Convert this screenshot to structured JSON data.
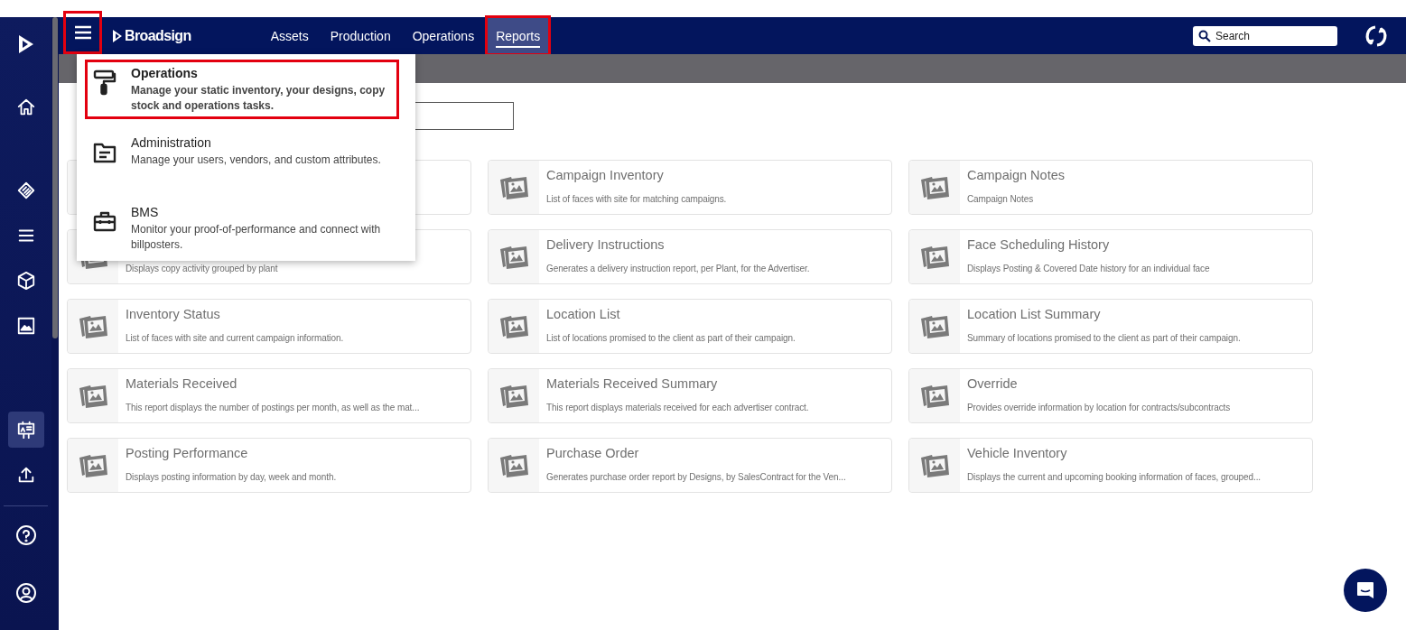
{
  "sidebar": {
    "items": [
      {
        "selected": false
      },
      {
        "selected": false
      },
      {
        "selected": false
      },
      {
        "selected": false
      },
      {
        "selected": false
      },
      {
        "selected": true
      },
      {
        "selected": false
      }
    ],
    "bottom_items": [
      {
        "selected": false
      },
      {
        "selected": false
      }
    ]
  },
  "header": {
    "menu_button": {
      "highlighted": true
    },
    "brand": "Broadsign",
    "tabs": [
      {
        "label": "Assets",
        "selected": false,
        "highlighted": false
      },
      {
        "label": "Production",
        "selected": false,
        "highlighted": false
      },
      {
        "label": "Operations",
        "selected": false,
        "highlighted": false
      },
      {
        "label": "Reports",
        "selected": true,
        "highlighted": true
      }
    ],
    "search": {
      "placeholder": "Search"
    }
  },
  "app_menu": {
    "items": [
      {
        "title": "Operations",
        "description": "Manage your static inventory, your designs, copy stock and operations tasks.",
        "highlighted": true
      },
      {
        "title": "Administration",
        "description": "Manage your users, vendors, and custom attributes.",
        "highlighted": false
      },
      {
        "title": "BMS",
        "description": "Monitor your proof-of-performance and connect with billposters.",
        "highlighted": false
      }
    ]
  },
  "report_rows": [
    {
      "cards": [
        {
          "kind": "covered"
        },
        {
          "kind": "report",
          "title": "Campaign Inventory",
          "description": "List of faces with site for matching campaigns."
        },
        {
          "kind": "report",
          "title": "Campaign Notes",
          "description": "Campaign Notes"
        }
      ]
    },
    {
      "cards": [
        {
          "kind": "covered",
          "description": "Displays copy activity grouped by plant"
        },
        {
          "kind": "report",
          "title": "Delivery Instructions",
          "description": "Generates a delivery instruction report, per Plant, for the Advertiser."
        },
        {
          "kind": "report",
          "title": "Face Scheduling History",
          "description": "Displays Posting & Covered Date history for an individual face"
        }
      ]
    },
    {
      "cards": [
        {
          "kind": "report",
          "title": "Inventory Status",
          "description": "List of faces with site and current campaign information."
        },
        {
          "kind": "report",
          "title": "Location List",
          "description": "List of locations promised to the client as part of their campaign."
        },
        {
          "kind": "report",
          "title": "Location List Summary",
          "description": "Summary of locations promised to the client as part of their campaign."
        }
      ]
    },
    {
      "cards": [
        {
          "kind": "report",
          "title": "Materials Received",
          "description": "This report displays the number of postings per month, as well as the mat..."
        },
        {
          "kind": "report",
          "title": "Materials Received Summary",
          "description": "This report displays materials received for each advertiser contract."
        },
        {
          "kind": "report",
          "title": "Override",
          "description": "Provides override information by location for contracts/subcontracts"
        }
      ]
    },
    {
      "cards": [
        {
          "kind": "report",
          "title": "Posting Performance",
          "description": "Displays posting information by day, week and month."
        },
        {
          "kind": "report",
          "title": "Purchase Order",
          "description": "Generates purchase order report by Designs, by SalesContract for the Ven..."
        },
        {
          "kind": "report",
          "title": "Vehicle Inventory",
          "description": "Displays the current and upcoming booking information of faces, grouped..."
        }
      ]
    }
  ]
}
